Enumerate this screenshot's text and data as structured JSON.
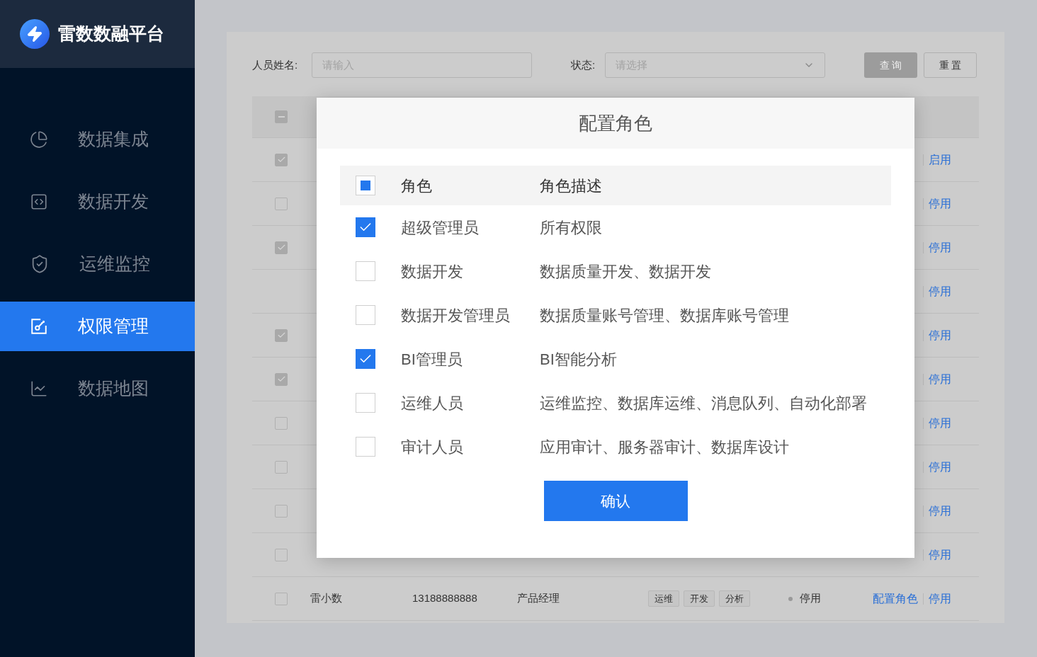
{
  "brand": {
    "name": "雷数数融平台"
  },
  "sidebar": {
    "items": [
      {
        "label": "数据集成",
        "selected": false
      },
      {
        "label": "数据开发",
        "selected": false
      },
      {
        "label": "运维监控",
        "selected": false
      },
      {
        "label": "权限管理",
        "selected": true
      },
      {
        "label": "数据地图",
        "selected": false
      }
    ]
  },
  "filters": {
    "name_label": "人员姓名:",
    "name_placeholder": "请输入",
    "status_label": "状态:",
    "status_placeholder": "请选择",
    "query": "查 询",
    "reset": "重 置"
  },
  "table": {
    "header": {
      "indeterminate": true
    },
    "rows": [
      {
        "kind": "checkbox",
        "checked": true,
        "action": "启用"
      },
      {
        "kind": "checkbox",
        "checked": false,
        "action": "停用"
      },
      {
        "kind": "checkbox",
        "checked": true,
        "action": "停用"
      },
      {
        "kind": "plain",
        "action": "停用"
      },
      {
        "kind": "checkbox",
        "checked": true,
        "action": "停用"
      },
      {
        "kind": "checkbox",
        "checked": true,
        "action": "停用"
      },
      {
        "kind": "checkbox",
        "checked": false,
        "action": "停用"
      },
      {
        "kind": "checkbox",
        "checked": false,
        "action": "停用"
      },
      {
        "kind": "checkbox",
        "checked": false,
        "action": "停用"
      },
      {
        "kind": "checkbox",
        "checked": false,
        "action": "停用"
      },
      {
        "kind": "full",
        "checked": false,
        "name": "雷小数",
        "phone": "13188888888",
        "position": "产品经理",
        "tags": [
          "运维",
          "开发",
          "分析"
        ],
        "status": "停用",
        "configure": "配置角色",
        "action": "停用"
      }
    ]
  },
  "dialog": {
    "title": "配置角色",
    "header": {
      "indeterminate": true,
      "role": "角色",
      "description": "角色描述"
    },
    "roles": [
      {
        "checked": true,
        "role": "超级管理员",
        "description": "所有权限"
      },
      {
        "checked": false,
        "role": "数据开发",
        "description": "数据质量开发、数据开发"
      },
      {
        "checked": false,
        "role": "数据开发管理员",
        "description": "数据质量账号管理、数据库账号管理"
      },
      {
        "checked": true,
        "role": "BI管理员",
        "description": "BI智能分析"
      },
      {
        "checked": false,
        "role": "运维人员",
        "description": "运维监控、数据库运维、消息队列、自动化部署"
      },
      {
        "checked": false,
        "role": "审计人员",
        "description": "应用审计、服务器审计、数据库设计"
      }
    ],
    "confirm": "确认"
  }
}
